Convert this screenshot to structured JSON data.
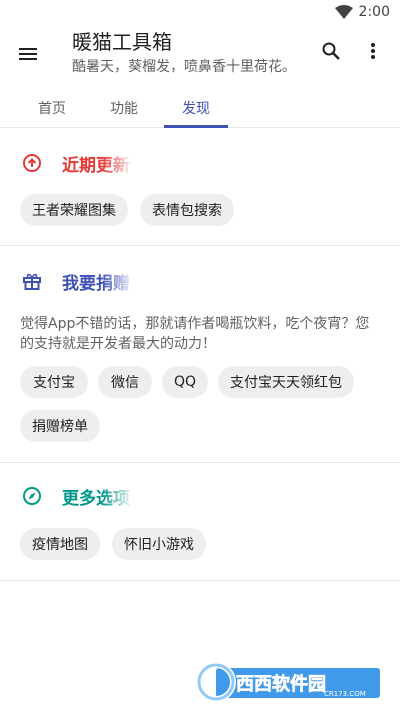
{
  "status_bar": {
    "time": "2:00",
    "icons": [
      "wifi-icon"
    ]
  },
  "app_bar": {
    "title": "暖猫工具箱",
    "subtitle": "酷暑天，葵榴发，喷鼻香十里荷花。",
    "icons": [
      "menu-icon",
      "search-icon",
      "more-vert-icon"
    ]
  },
  "tabs": [
    {
      "label": "首页",
      "active": false
    },
    {
      "label": "功能",
      "active": false
    },
    {
      "label": "发现",
      "active": true
    }
  ],
  "sections": {
    "recent": {
      "title": "近期更新",
      "icon": "arrow-up-circle-icon",
      "color": "#e53935",
      "chips": [
        "王者荣耀图集",
        "表情包搜索"
      ]
    },
    "donate": {
      "title": "我要捐赠",
      "icon": "gift-icon",
      "color": "#3f51b5",
      "description": "觉得App不错的话，那就请作者喝瓶饮料，吃个夜宵？您的支持就是开发者最大的动力！",
      "chips": [
        "支付宝",
        "微信",
        "QQ",
        "支付宝天天领红包",
        "捐赠榜单"
      ]
    },
    "more": {
      "title": "更多选项",
      "icon": "compass-icon",
      "color": "#009688",
      "chips": [
        "疫情地图",
        "怀旧小游戏"
      ]
    }
  },
  "watermark": {
    "brand": "西西软件园",
    "domain": "CR173.COM"
  },
  "colors": {
    "accent": "#3f51b5",
    "chip_bg": "#eeeeee"
  }
}
